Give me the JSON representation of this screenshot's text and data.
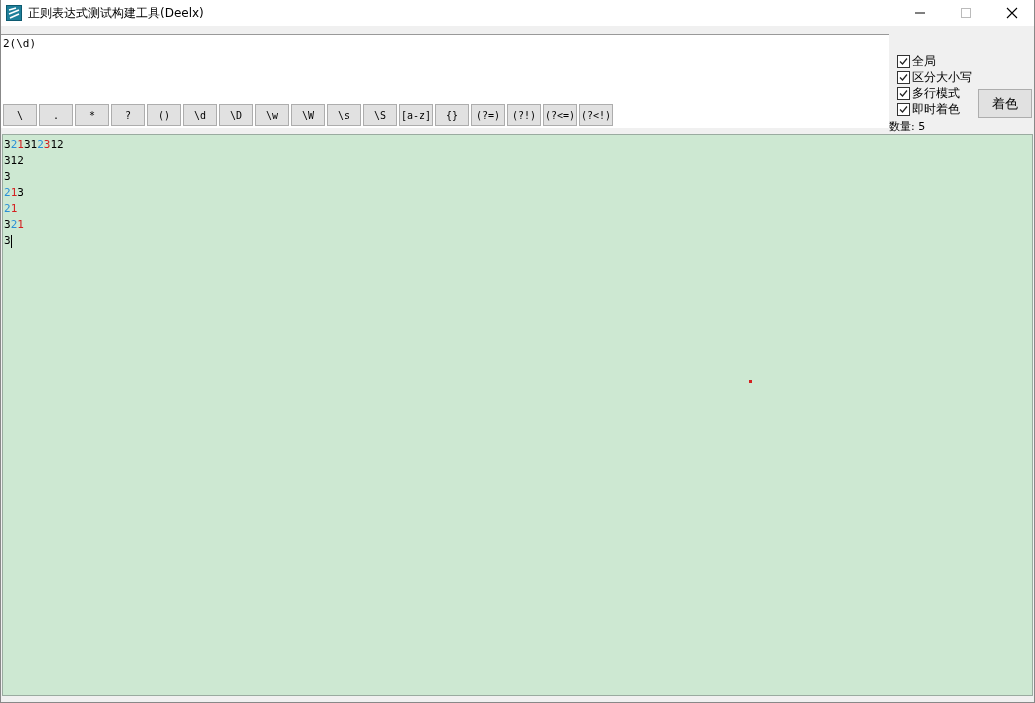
{
  "window": {
    "title": "正则表达式测试构建工具(Deelx)"
  },
  "pattern": {
    "value": "2(\\d)"
  },
  "tokens": [
    "\\",
    ".",
    "*",
    "?",
    "()",
    "\\d",
    "\\D",
    "\\w",
    "\\W",
    "\\s",
    "\\S",
    "[a-z]",
    "{}",
    "(?=)",
    "(?!)",
    "(?<=)",
    "(?<!)"
  ],
  "options": [
    {
      "label": "全局",
      "checked": true
    },
    {
      "label": "区分大小写",
      "checked": true
    },
    {
      "label": "多行模式",
      "checked": true
    },
    {
      "label": "即时着色",
      "checked": true
    }
  ],
  "colorize_button": "着色",
  "count": "数量: 5",
  "result_lines": [
    [
      {
        "text": "3",
        "color": "#000000"
      },
      {
        "text": "2",
        "color": "#2a8fd6"
      },
      {
        "text": "1",
        "color": "#d42020"
      },
      {
        "text": "31",
        "color": "#000000"
      },
      {
        "text": "2",
        "color": "#2a8fd6"
      },
      {
        "text": "3",
        "color": "#d42020"
      },
      {
        "text": "12",
        "color": "#000000"
      }
    ],
    [
      {
        "text": "312",
        "color": "#000000"
      }
    ],
    [
      {
        "text": "3",
        "color": "#000000"
      }
    ],
    [
      {
        "text": "2",
        "color": "#2a8fd6"
      },
      {
        "text": "1",
        "color": "#d42020"
      },
      {
        "text": "3",
        "color": "#000000"
      }
    ],
    [
      {
        "text": "2",
        "color": "#2a8fd6"
      },
      {
        "text": "1",
        "color": "#d42020"
      }
    ],
    [
      {
        "text": "3",
        "color": "#000000"
      },
      {
        "text": "2",
        "color": "#2a8fd6"
      },
      {
        "text": "1",
        "color": "#d42020"
      }
    ],
    [
      {
        "text": "3",
        "color": "#000000"
      }
    ]
  ]
}
